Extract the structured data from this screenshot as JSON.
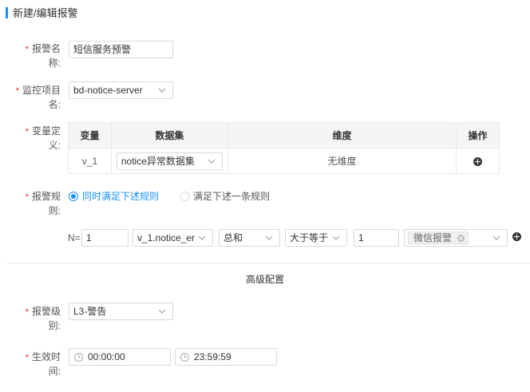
{
  "header": {
    "title": "新建/编辑报警"
  },
  "form": {
    "name": {
      "label_line1": "报警名",
      "label_line2": "称:",
      "value": "短信服务预警"
    },
    "project": {
      "label_line1": "监控项目",
      "label_line2": "名:",
      "value": "bd-notice-server"
    },
    "variables": {
      "label_line1": "变量定",
      "label_line2": "义:",
      "columns": [
        "变量",
        "数据集",
        "维度",
        "操作"
      ],
      "rows": [
        {
          "variable": "v_1",
          "dataset": "notice异常数据集",
          "dimension": "无维度"
        }
      ]
    },
    "rules": {
      "label_line1": "报警规",
      "label_line2": "则:",
      "options": [
        "同时满足下述规则",
        "满足下述一条规则"
      ],
      "selected": "同时满足下述规则",
      "rule": {
        "n_label": "N=",
        "n_value": "1",
        "variable": "v_1.notice_er",
        "aggregate": "总和",
        "operator": "大于等于",
        "threshold": "1",
        "channel_tag": "微信报警"
      }
    }
  },
  "advanced": {
    "section_title": "高级配置",
    "level": {
      "label_line1": "报警级",
      "label_line2": "别:",
      "value": "L3-警告"
    },
    "time": {
      "label_line1": "生效时",
      "label_line2": "间:",
      "start": "00:00:00",
      "end": "23:59:59"
    }
  },
  "colors": {
    "accent": "#1890ff",
    "required": "#f5222d",
    "border": "#d9d9d9"
  }
}
